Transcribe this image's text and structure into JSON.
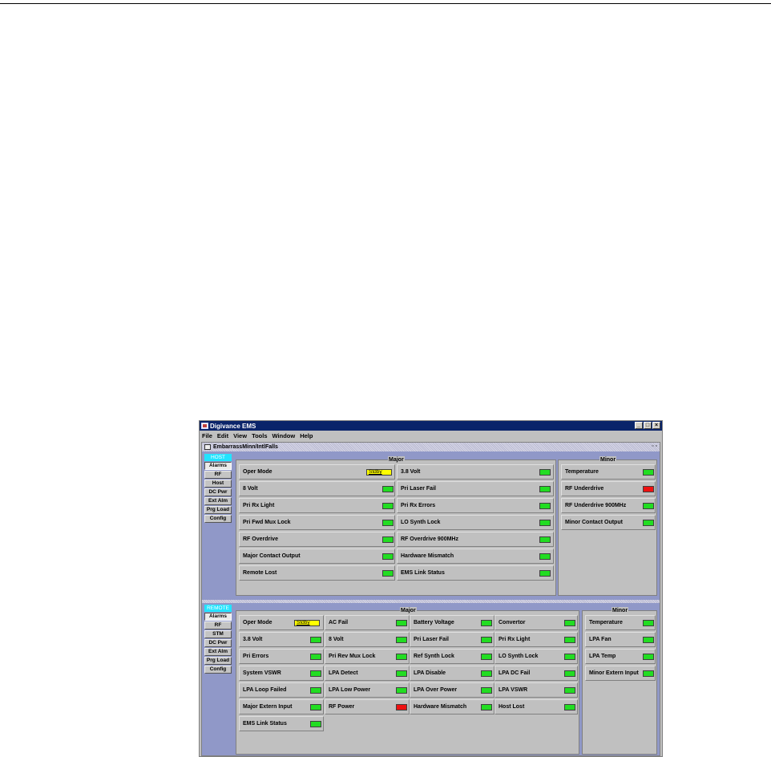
{
  "window": {
    "title": "Digivance EMS",
    "controls": [
      "_",
      "□",
      "×"
    ]
  },
  "menu": [
    "File",
    "Edit",
    "View",
    "Tools",
    "Window",
    "Help"
  ],
  "internal_frame": {
    "title": "EmbarrassMinn/IntlFalls",
    "controls": "▫ ▫"
  },
  "host": {
    "header": "HOST",
    "nav": [
      "Alarms",
      "RF",
      "Host",
      "DC Pwr",
      "Ext Alm",
      "Prg Load",
      "Config"
    ],
    "selected_nav": "Alarms",
    "major_title": "Major",
    "minor_title": "Minor",
    "major_col1": [
      {
        "label": "Oper Mode",
        "status": "yellow",
        "text": "Stdby"
      },
      {
        "label": "8 Volt",
        "status": "green"
      },
      {
        "label": "Pri Rx Light",
        "status": "green"
      },
      {
        "label": "Pri Fwd Mux Lock",
        "status": "green"
      },
      {
        "label": "RF Overdrive",
        "status": "green"
      },
      {
        "label": "Major Contact Output",
        "status": "green"
      },
      {
        "label": "Remote Lost",
        "status": "green"
      }
    ],
    "major_col2": [
      {
        "label": "3.8 Volt",
        "status": "green"
      },
      {
        "label": "Pri Laser Fail",
        "status": "green"
      },
      {
        "label": "Pri Rx Errors",
        "status": "green"
      },
      {
        "label": "LO Synth Lock",
        "status": "green"
      },
      {
        "label": "RF Overdrive 900MHz",
        "status": "green"
      },
      {
        "label": "Hardware Mismatch",
        "status": "green"
      },
      {
        "label": "EMS Link Status",
        "status": "green"
      }
    ],
    "minor": [
      {
        "label": "Temperature",
        "status": "green"
      },
      {
        "label": "RF Underdrive",
        "status": "red"
      },
      {
        "label": "RF Underdrive 900MHz",
        "status": "green"
      },
      {
        "label": "Minor Contact Output",
        "status": "green"
      }
    ]
  },
  "remote": {
    "header": "REMOTE",
    "nav": [
      "Alarms",
      "RF",
      "STM",
      "DC Pwr",
      "Ext Alm",
      "Prg Load",
      "Config"
    ],
    "selected_nav": "Alarms",
    "major_title": "Major",
    "minor_title": "Minor",
    "major_col1": [
      {
        "label": "Oper Mode",
        "status": "yellow",
        "text": "Stdby"
      },
      {
        "label": "3.8 Volt",
        "status": "green"
      },
      {
        "label": "Pri Errors",
        "status": "green"
      },
      {
        "label": "System VSWR",
        "status": "green"
      },
      {
        "label": "LPA Loop Failed",
        "status": "green"
      },
      {
        "label": "Major Extern Input",
        "status": "green"
      },
      {
        "label": "EMS Link Status",
        "status": "green"
      }
    ],
    "major_col2": [
      {
        "label": "AC Fail",
        "status": "green"
      },
      {
        "label": "8 Volt",
        "status": "green"
      },
      {
        "label": "Pri Rev Mux Lock",
        "status": "green"
      },
      {
        "label": "LPA Detect",
        "status": "green"
      },
      {
        "label": "LPA Low Power",
        "status": "green"
      },
      {
        "label": "RF Power",
        "status": "red"
      }
    ],
    "major_col3": [
      {
        "label": "Battery Voltage",
        "status": "green"
      },
      {
        "label": "Pri Laser Fail",
        "status": "green"
      },
      {
        "label": "Ref Synth Lock",
        "status": "green"
      },
      {
        "label": "LPA Disable",
        "status": "green"
      },
      {
        "label": "LPA Over Power",
        "status": "green"
      },
      {
        "label": "Hardware Mismatch",
        "status": "green"
      }
    ],
    "major_col4": [
      {
        "label": "Convertor",
        "status": "green"
      },
      {
        "label": "Pri Rx Light",
        "status": "green"
      },
      {
        "label": "LO Synth Lock",
        "status": "green"
      },
      {
        "label": "LPA DC Fail",
        "status": "green"
      },
      {
        "label": "LPA VSWR",
        "status": "green"
      },
      {
        "label": "Host Lost",
        "status": "green"
      }
    ],
    "minor": [
      {
        "label": "Temperature",
        "status": "green"
      },
      {
        "label": "LPA Fan",
        "status": "green"
      },
      {
        "label": "LPA Temp",
        "status": "green"
      },
      {
        "label": "Minor Extern Input",
        "status": "green"
      }
    ]
  }
}
